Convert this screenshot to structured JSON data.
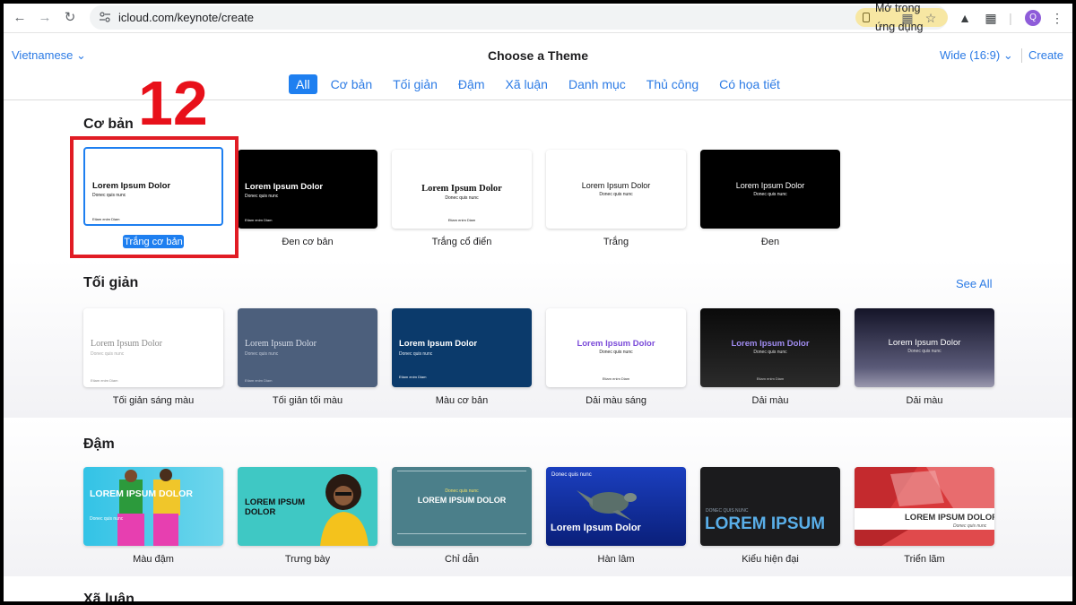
{
  "browser": {
    "url": "icloud.com/keynote/create",
    "open_app_label": "Mở trong ứng dụng",
    "avatar_initial": "Q"
  },
  "header": {
    "language": "Vietnamese",
    "title": "Choose a Theme",
    "aspect_ratio": "Wide (16:9)",
    "create_label": "Create"
  },
  "filters": [
    {
      "label": "All",
      "active": true
    },
    {
      "label": "Cơ bản"
    },
    {
      "label": "Tối giản"
    },
    {
      "label": "Đậm"
    },
    {
      "label": "Xã luận"
    },
    {
      "label": "Danh mục"
    },
    {
      "label": "Thủ công"
    },
    {
      "label": "Có họa tiết"
    }
  ],
  "annotation": {
    "step_number": "12",
    "highlight_color": "#e11c24"
  },
  "sections": {
    "basic": {
      "title": "Cơ bản",
      "themes": [
        {
          "label": "Trắng cơ bản",
          "selected": true,
          "thumb_title": "Lorem Ipsum Dolor",
          "thumb_sub": "Donec quis nunc",
          "thumb_foot": "Etiam enim Diam"
        },
        {
          "label": "Đen cơ bản",
          "thumb_title": "Lorem Ipsum Dolor",
          "thumb_sub": "Donec quis nunc",
          "thumb_foot": "Etiam enim Diam"
        },
        {
          "label": "Trắng cổ điển",
          "thumb_title": "Lorem Ipsum Dolor",
          "thumb_sub": "Donec quis nunc",
          "thumb_foot": "Etiam enim Diam"
        },
        {
          "label": "Trắng",
          "thumb_title": "Lorem Ipsum Dolor",
          "thumb_sub": "Donec quis nunc"
        },
        {
          "label": "Đen",
          "thumb_title": "Lorem Ipsum Dolor",
          "thumb_sub": "Donec quis nunc"
        }
      ]
    },
    "minimal": {
      "title": "Tối giản",
      "see_all": "See All",
      "themes": [
        {
          "label": "Tối giản sáng màu",
          "thumb_title": "Lorem Ipsum Dolor",
          "thumb_sub": "Donec quis nunc",
          "thumb_foot": "Etiam enim Diam"
        },
        {
          "label": "Tối giản tối màu",
          "thumb_title": "Lorem Ipsum Dolor",
          "thumb_sub": "Donec quis nunc",
          "thumb_foot": "Etiam enim Diam"
        },
        {
          "label": "Màu cơ bản",
          "thumb_title": "Lorem Ipsum Dolor",
          "thumb_sub": "Donec quis nunc",
          "thumb_foot": "Etiam enim Diam"
        },
        {
          "label": "Dải màu sáng",
          "thumb_title": "Lorem Ipsum Dolor",
          "thumb_sub": "Donec quis nunc",
          "thumb_foot": "Etiam enim Diam"
        },
        {
          "label": "Dải màu",
          "thumb_title": "Lorem Ipsum Dolor",
          "thumb_sub": "Donec quis nunc",
          "thumb_foot": "Etiam enim Diam"
        },
        {
          "label": "Dải màu",
          "thumb_title": "Lorem Ipsum Dolor",
          "thumb_sub": "Donec quis nunc"
        }
      ]
    },
    "bold": {
      "title": "Đậm",
      "themes": [
        {
          "label": "Màu đậm",
          "thumb_title": "LOREM IPSUM DOLOR",
          "thumb_sub": "Donec quis nunc"
        },
        {
          "label": "Trưng bày",
          "thumb_title": "LOREM IPSUM DOLOR"
        },
        {
          "label": "Chỉ dẫn",
          "thumb_title": "LOREM IPSUM DOLOR",
          "thumb_sub": "Donec quis nunc"
        },
        {
          "label": "Hàn lâm",
          "thumb_title": "Lorem Ipsum Dolor",
          "thumb_sub": "Donec quis nunc"
        },
        {
          "label": "Kiểu hiện đại",
          "thumb_title": "LOREM IPSUM",
          "thumb_sub": "DONEC QUIS NUNC"
        },
        {
          "label": "Triển lãm",
          "thumb_title": "LOREM IPSUM DOLOR",
          "thumb_sub": "Donec quis nunc"
        }
      ]
    },
    "editorial": {
      "title": "Xã luận"
    }
  }
}
